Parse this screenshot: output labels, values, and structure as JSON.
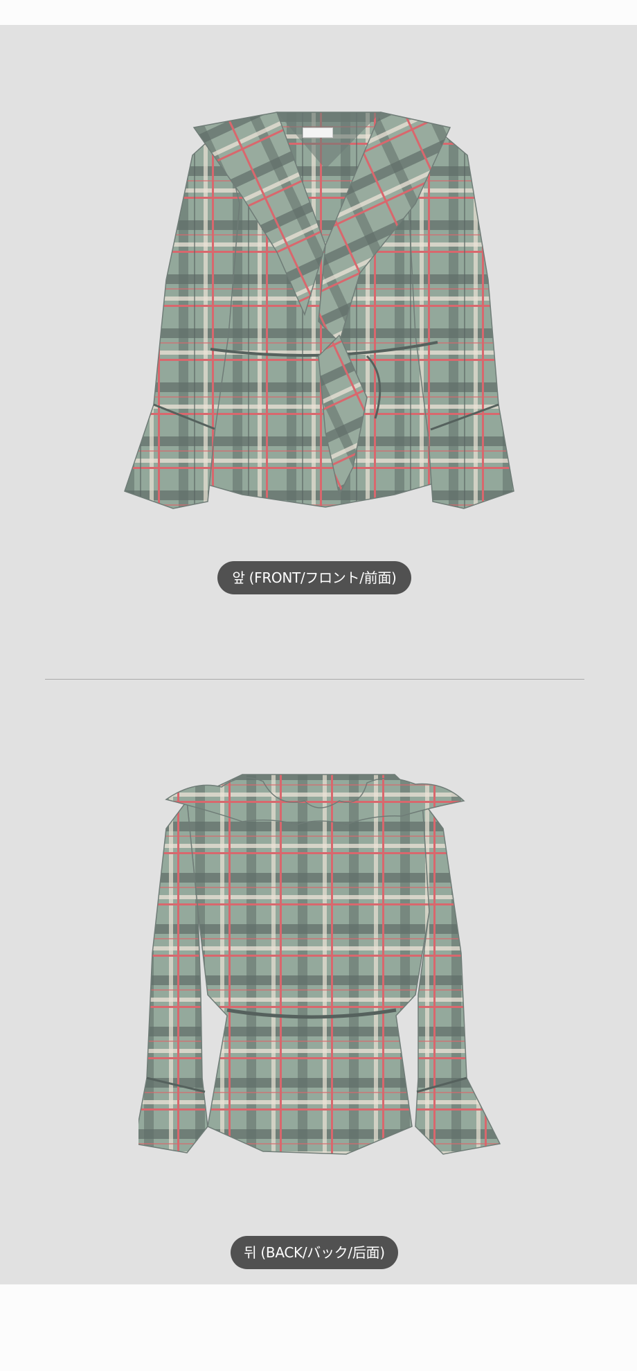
{
  "front": {
    "caption": "앞 (FRONT/フロント/前面)"
  },
  "back": {
    "caption": "뒤 (BACK/バック/后面)"
  },
  "colors": {
    "panel": "#e1e1e1",
    "page": "#fcfcfc",
    "pill": "#515151",
    "fabric_base": "#8fa597",
    "fabric_dark": "#5d6a66",
    "fabric_red": "#d86a6f",
    "fabric_cream": "#ece3d6"
  }
}
